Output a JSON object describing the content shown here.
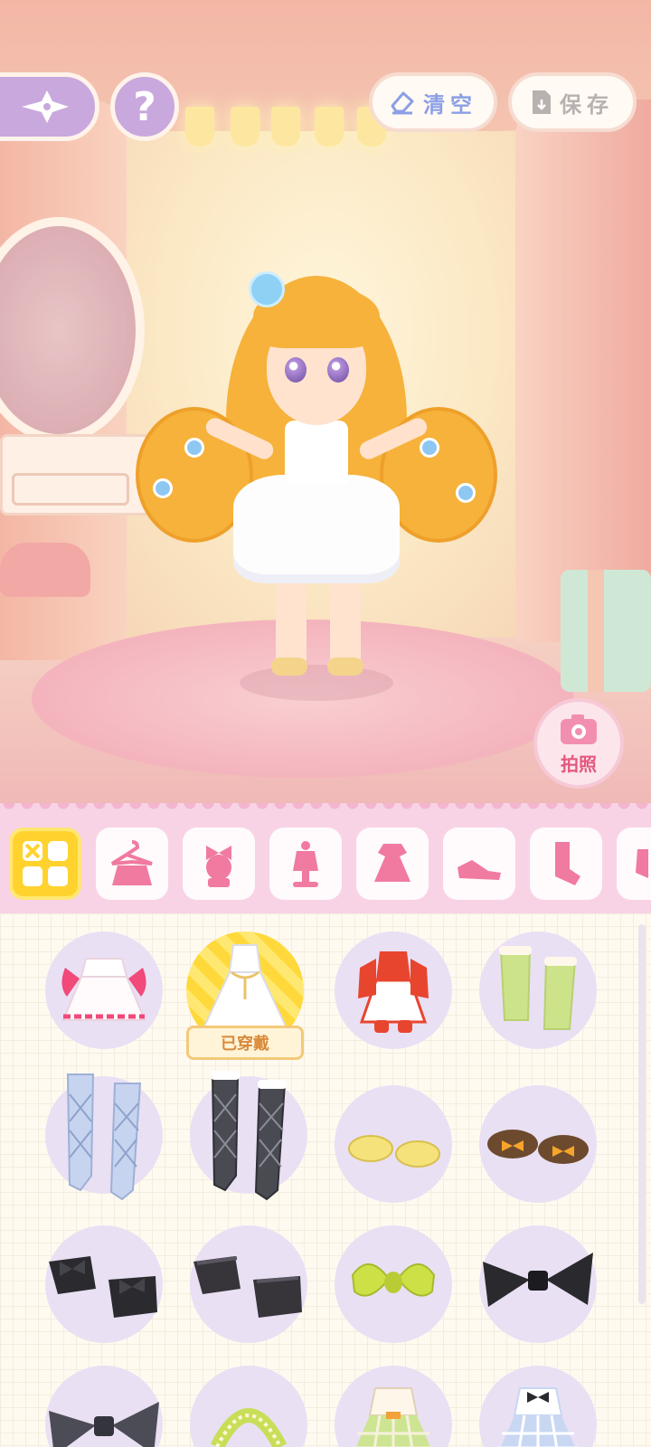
{
  "top_bar": {
    "back_icon": "sparkle-back-icon",
    "help_label": "?",
    "clear_label": "清空",
    "save_label": "保存"
  },
  "photo_button": {
    "label": "拍照"
  },
  "categories": [
    {
      "name": "all-icon",
      "active": true
    },
    {
      "name": "outfit-set-icon",
      "active": false
    },
    {
      "name": "hair-accessory-icon",
      "active": false
    },
    {
      "name": "top-icon",
      "active": false
    },
    {
      "name": "dress-icon",
      "active": false
    },
    {
      "name": "shoes-icon",
      "active": false
    },
    {
      "name": "socks-icon",
      "active": false
    },
    {
      "name": "more-icon",
      "active": false
    }
  ],
  "wardrobe": {
    "equipped_badge": "已穿戴",
    "items": [
      {
        "name": "pink-white-dress",
        "color": "#f0497a"
      },
      {
        "name": "white-gold-dress",
        "color": "#ffffff",
        "equipped": true
      },
      {
        "name": "red-qipao-dress",
        "color": "#e8452f"
      },
      {
        "name": "green-leg-warmers",
        "color": "#cde38a"
      },
      {
        "name": "blue-argyle-stockings",
        "color": "#c6d4ef"
      },
      {
        "name": "black-argyle-stockings",
        "color": "#4a4a52"
      },
      {
        "name": "yellow-slippers",
        "color": "#f5e27a"
      },
      {
        "name": "brown-bow-shoes",
        "color": "#6d4a2e"
      },
      {
        "name": "black-bow-shoes",
        "color": "#2b2b2f"
      },
      {
        "name": "dark-ribbon-shoes",
        "color": "#37343a"
      },
      {
        "name": "lime-hair-bow",
        "color": "#cde045"
      },
      {
        "name": "black-hair-bow",
        "color": "#2a2a2e"
      },
      {
        "name": "grey-hair-bow",
        "color": "#4c4c56"
      },
      {
        "name": "green-headband",
        "color": "#c9de58"
      },
      {
        "name": "green-plaid-dress",
        "color": "#cde592"
      },
      {
        "name": "blue-plaid-dress",
        "color": "#c9d7f2"
      }
    ]
  }
}
